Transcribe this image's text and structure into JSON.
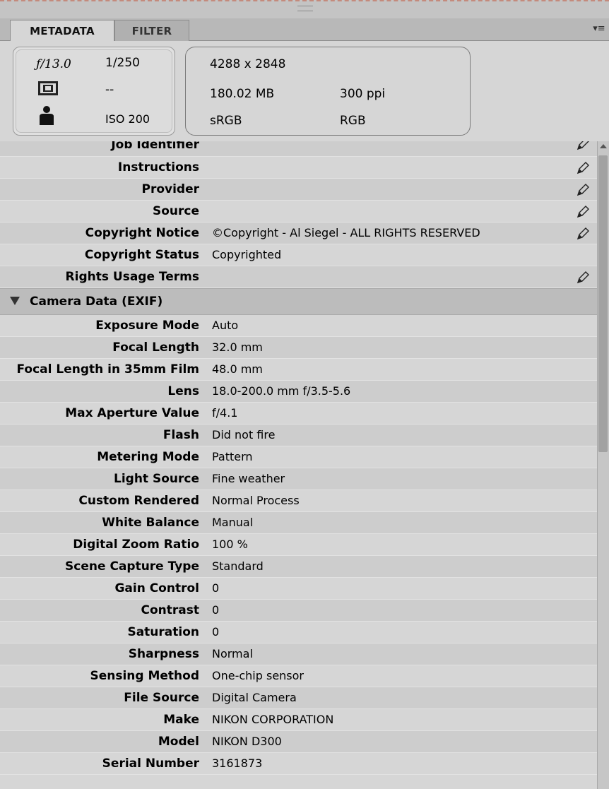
{
  "tabs": [
    {
      "label": "METADATA",
      "active": true
    },
    {
      "label": "FILTER",
      "active": false
    }
  ],
  "camera": {
    "fstop": "ƒ/13.0",
    "shutter": "1/250",
    "metering": "--",
    "iso": "ISO 200"
  },
  "file": {
    "dimensions": "4288 x 2848",
    "size": "180.02 MB",
    "resolution": "300 ppi",
    "color_profile": "sRGB",
    "color_mode": "RGB"
  },
  "iptc_rows": [
    {
      "label": "Job Identifier",
      "value": "",
      "editable": true
    },
    {
      "label": "Instructions",
      "value": "",
      "editable": true
    },
    {
      "label": "Provider",
      "value": "",
      "editable": true
    },
    {
      "label": "Source",
      "value": "",
      "editable": true
    },
    {
      "label": "Copyright Notice",
      "value": "©Copyright - Al Siegel - ALL RIGHTS RESERVED",
      "editable": true
    },
    {
      "label": "Copyright Status",
      "value": "Copyrighted",
      "editable": false
    },
    {
      "label": "Rights Usage Terms",
      "value": "",
      "editable": true
    }
  ],
  "exif_section": {
    "title": "Camera Data (EXIF)"
  },
  "exif_rows": [
    {
      "label": "Exposure Mode",
      "value": "Auto"
    },
    {
      "label": "Focal Length",
      "value": "32.0 mm"
    },
    {
      "label": "Focal Length in 35mm Film",
      "value": "48.0 mm"
    },
    {
      "label": "Lens",
      "value": "18.0-200.0 mm f/3.5-5.6"
    },
    {
      "label": "Max Aperture Value",
      "value": "f/4.1"
    },
    {
      "label": "Flash",
      "value": "Did not fire"
    },
    {
      "label": "Metering Mode",
      "value": "Pattern"
    },
    {
      "label": "Light Source",
      "value": "Fine weather"
    },
    {
      "label": "Custom Rendered",
      "value": "Normal Process"
    },
    {
      "label": "White Balance",
      "value": "Manual"
    },
    {
      "label": "Digital Zoom Ratio",
      "value": "100 %"
    },
    {
      "label": "Scene Capture Type",
      "value": "Standard"
    },
    {
      "label": "Gain Control",
      "value": "0"
    },
    {
      "label": "Contrast",
      "value": "0"
    },
    {
      "label": "Saturation",
      "value": "0"
    },
    {
      "label": "Sharpness",
      "value": "Normal"
    },
    {
      "label": "Sensing Method",
      "value": "One-chip sensor"
    },
    {
      "label": "File Source",
      "value": "Digital Camera"
    },
    {
      "label": "Make",
      "value": "NIKON CORPORATION"
    },
    {
      "label": "Model",
      "value": "NIKON D300"
    },
    {
      "label": "Serial Number",
      "value": "3161873"
    }
  ],
  "icons": {
    "edit": "pencil-icon",
    "metering": "matrix-metering-icon",
    "exposure_program": "person-icon",
    "panel_menu": "panel-menu-icon",
    "collapse": "disclosure-triangle-icon"
  }
}
